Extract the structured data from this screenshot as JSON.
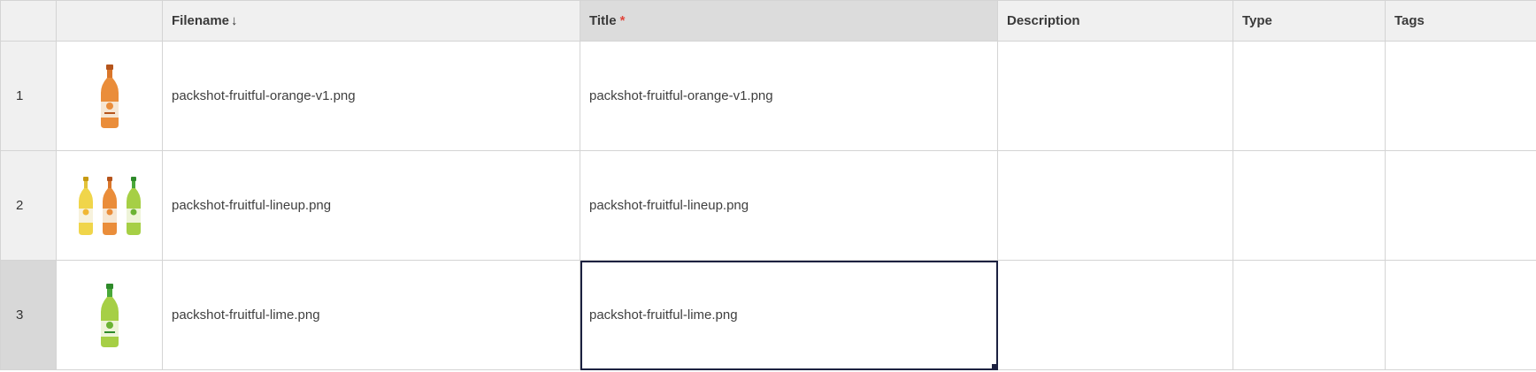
{
  "columns": {
    "filename": "Filename",
    "title": "Title",
    "title_required": "*",
    "description": "Description",
    "type": "Type",
    "tags": "Tags"
  },
  "sort": {
    "column": "Filename",
    "direction": "descending",
    "icon": "arrow-down-icon"
  },
  "colors": {
    "header_bg": "#f0f0f0",
    "selected_border": "#1c2140",
    "required_mark": "#e0463c",
    "grid_line": "#d4d4d4"
  },
  "rows": [
    {
      "number": "1",
      "thumbnail": "orange-bottle-thumbnail",
      "filename": "packshot-fruitful-orange-v1.png",
      "title": "packshot-fruitful-orange-v1.png",
      "description": "",
      "type": "",
      "tags": ""
    },
    {
      "number": "2",
      "thumbnail": "three-bottles-thumbnail",
      "filename": "packshot-fruitful-lineup.png",
      "title": "packshot-fruitful-lineup.png",
      "description": "",
      "type": "",
      "tags": ""
    },
    {
      "number": "3",
      "thumbnail": "lime-bottle-thumbnail",
      "filename": "packshot-fruitful-lime.png",
      "title": "packshot-fruitful-lime.png",
      "description": "",
      "type": "",
      "tags": "",
      "selected_cell": "title"
    }
  ]
}
